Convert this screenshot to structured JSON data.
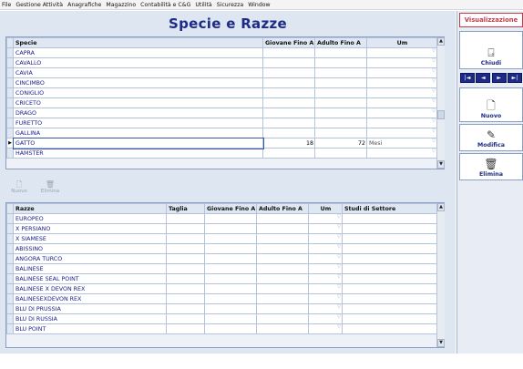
{
  "menubar": [
    "File",
    "Gestione Attività",
    "Anagrafiche",
    "Magazzino",
    "Contabilità e C&G",
    "Utilità",
    "Sicurezza",
    "Window"
  ],
  "window": {
    "title": "Specie e Razze"
  },
  "species_grid": {
    "columns": [
      "Specie",
      "Giovane Fino A",
      "Adulto Fino A",
      "Um"
    ],
    "rows": [
      {
        "name": "CAPRA",
        "young": "",
        "adult": "",
        "um": ""
      },
      {
        "name": "CAVALLO",
        "young": "",
        "adult": "",
        "um": ""
      },
      {
        "name": "CAVIA",
        "young": "",
        "adult": "",
        "um": ""
      },
      {
        "name": "CINCIMBO",
        "young": "",
        "adult": "",
        "um": ""
      },
      {
        "name": "CONIGLIO",
        "young": "",
        "adult": "",
        "um": ""
      },
      {
        "name": "CRICETO",
        "young": "",
        "adult": "",
        "um": ""
      },
      {
        "name": "DRAGO",
        "young": "",
        "adult": "",
        "um": ""
      },
      {
        "name": "FURETTO",
        "young": "",
        "adult": "",
        "um": ""
      },
      {
        "name": "GALLINA",
        "young": "",
        "adult": "",
        "um": ""
      },
      {
        "name": "GATTO",
        "young": "18",
        "adult": "72",
        "um": "Mesi",
        "current": true
      },
      {
        "name": "HAMSTER",
        "young": "",
        "adult": "",
        "um": ""
      }
    ]
  },
  "sub_toolbar": {
    "new_label": "Nuovo",
    "delete_label": "Elimina"
  },
  "breed_grid": {
    "columns": [
      "Razze",
      "Taglia",
      "Giovane Fino A",
      "Adulto Fino A",
      "Um",
      "Studi di Settore"
    ],
    "rows": [
      {
        "name": "EUROPEO"
      },
      {
        "name": "X PERSIANO"
      },
      {
        "name": "X SIAMESE"
      },
      {
        "name": "ABISSINO"
      },
      {
        "name": "ANGORA TURCO"
      },
      {
        "name": "BALINESE"
      },
      {
        "name": "BALINESE SEAL POINT"
      },
      {
        "name": "BALINESE X DEVON REX"
      },
      {
        "name": "BALINESEXDEVON REX"
      },
      {
        "name": "BLU DI PRUSSIA"
      },
      {
        "name": "BLU DI RUSSIA"
      },
      {
        "name": "BLU POINT"
      }
    ]
  },
  "sidebar": {
    "header": "Visualizzazione",
    "close_label": "Chiudi",
    "new_label": "Nuovo",
    "edit_label": "Modifica",
    "delete_label": "Elimina",
    "nav": [
      "|◄",
      "◄",
      "►",
      "►|"
    ]
  },
  "colors": {
    "title": "#1e2a88",
    "accent": "#c03a4a",
    "background": "#dde6f1"
  }
}
